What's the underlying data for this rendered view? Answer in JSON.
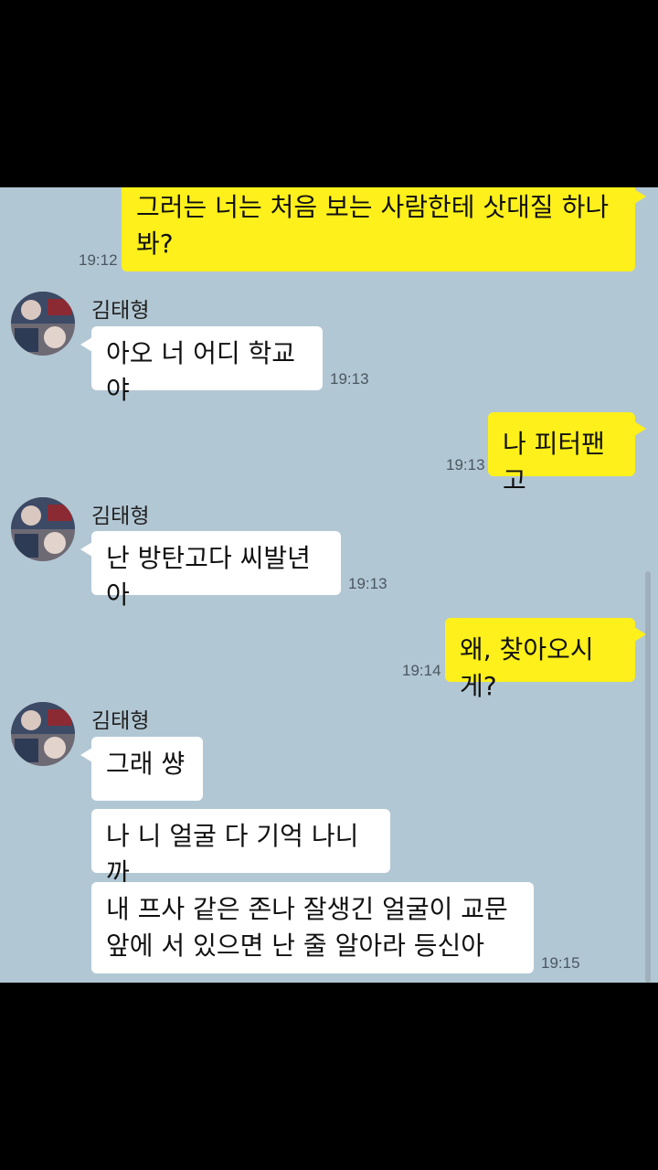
{
  "sender_name": "김태형",
  "messages": {
    "m1": {
      "text": "그러는 너는 처음 보는 사람한테 삿대질 하나 봐?",
      "time": "19:12"
    },
    "m2": {
      "text": "아오 너 어디 학교야",
      "time": "19:13"
    },
    "m3": {
      "text": "나 피터팬고",
      "time": "19:13"
    },
    "m4": {
      "text": "난 방탄고다 씨발년아",
      "time": "19:13"
    },
    "m5": {
      "text": "왜, 찾아오시게?",
      "time": "19:14"
    },
    "m6": {
      "text": "그래 썅"
    },
    "m7": {
      "text": "나 니 얼굴 다 기억 나니까"
    },
    "m8": {
      "text": "내 프사 같은 존나 잘생긴 얼굴이 교문 앞에 서 있으면 난 줄 알아라 등신아",
      "time": "19:15"
    }
  },
  "colors": {
    "chat_background": "#b2c7d4",
    "my_bubble": "#fef01b",
    "other_bubble": "#ffffff",
    "outside": "#000000"
  },
  "icons": {
    "avatar": "profile-photo"
  }
}
